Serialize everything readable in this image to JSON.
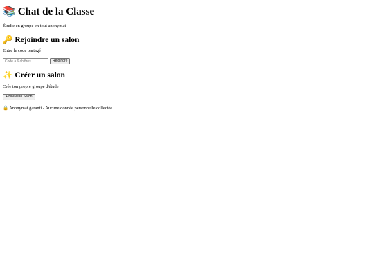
{
  "header": {
    "icon": "books-icon",
    "icon_glyph": "📚",
    "title": "Chat de la Classe",
    "subtitle": "Étudie en groupe en tout anonymat"
  },
  "join": {
    "icon": "key-icon",
    "icon_glyph": "🔑",
    "heading": "Rejoindre un salon",
    "description": "Entre le code partagé",
    "input_placeholder": "Code à 6 chiffres",
    "input_value": "",
    "button_label": "Rejoindre"
  },
  "create": {
    "icon": "sparkles-icon",
    "icon_glyph": "✨",
    "heading": "Créer un salon",
    "description": "Crée ton propre groupe d'étude",
    "button_label": "+ Nouveau Salon"
  },
  "footer": {
    "icon": "lock-icon",
    "icon_glyph": "🔒",
    "text": "Anonymat garanti - Aucune donnée personnelle collectée"
  }
}
